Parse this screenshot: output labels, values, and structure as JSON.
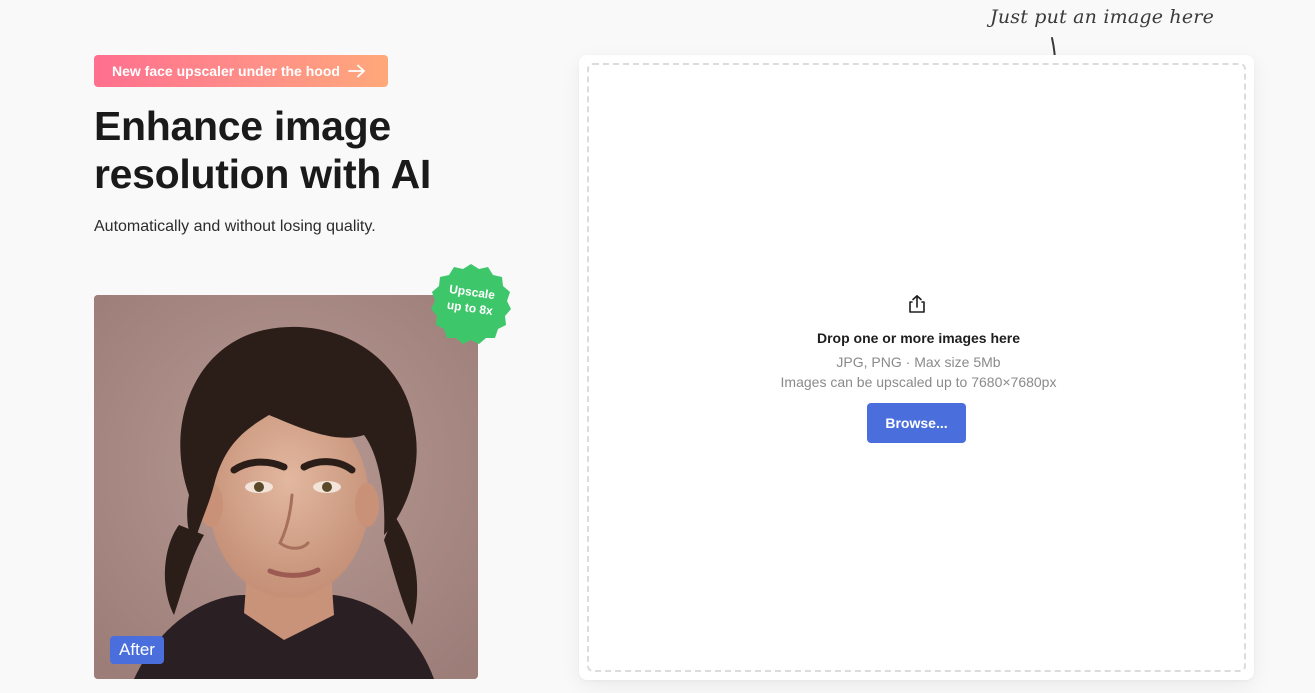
{
  "hero": {
    "promo_label": "New face upscaler under the hood",
    "headline_line1": "Enhance image",
    "headline_line2": "resolution with AI",
    "subheadline": "Automatically and without losing quality."
  },
  "preview": {
    "badge_line1": "Upscale",
    "badge_line2": "up to 8x",
    "after_label": "After"
  },
  "upload": {
    "hint": "Just put an image here",
    "title": "Drop one or more images here",
    "formats": "JPG, PNG · Max size 5Mb",
    "max_resolution": "Images can be upscaled up to 7680×7680px",
    "browse_label": "Browse..."
  },
  "icons": {
    "promo_arrow": "arrow-right-icon",
    "upload": "upload-share-icon",
    "hint_arrow": "hand-drawn-arrow-down-icon"
  },
  "colors": {
    "accent_blue": "#4a6fdc",
    "badge_green": "#3ec76a",
    "promo_gradient_start": "#ff6f8e",
    "promo_gradient_end": "#ffa87a",
    "page_background": "#f9f9f9"
  }
}
